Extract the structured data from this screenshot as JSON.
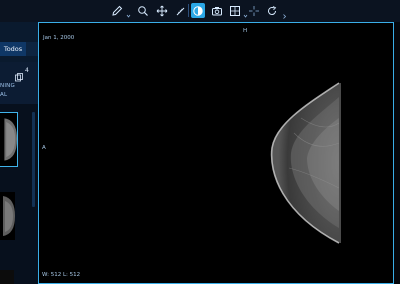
{
  "toolbar": {
    "tools": [
      {
        "name": "annotate-pencil-icon",
        "active": false
      },
      {
        "name": "zoom-magnifier-icon",
        "active": false
      },
      {
        "name": "pan-move-icon",
        "active": false
      },
      {
        "name": "measure-ruler-icon",
        "active": false
      },
      {
        "name": "window-level-contrast-icon",
        "active": true
      },
      {
        "name": "capture-camera-icon",
        "active": false
      },
      {
        "name": "layout-grid-icon",
        "active": false
      },
      {
        "name": "crosshair-icon",
        "active": false
      },
      {
        "name": "reset-rotate-icon",
        "active": false
      }
    ],
    "accent": "#2aa7e6"
  },
  "left_panel": {
    "tab_label": "Todos",
    "series_count": "4",
    "study_text_line1": "NING",
    "study_text_line2": "AL"
  },
  "viewport": {
    "date": "Jan 1, 2000",
    "orientation_top": "H",
    "orientation_left": "A",
    "window_level": "W: 512 L: 512",
    "border_color": "#3aaee8"
  }
}
